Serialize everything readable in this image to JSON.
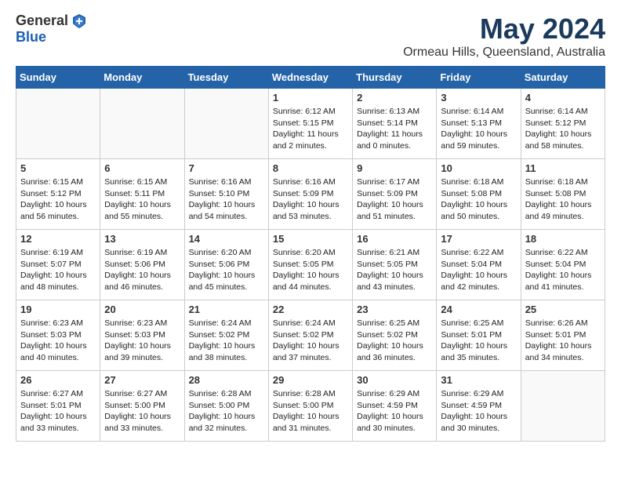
{
  "header": {
    "logo_line1": "General",
    "logo_line2": "Blue",
    "month_title": "May 2024",
    "location": "Ormeau Hills, Queensland, Australia"
  },
  "weekdays": [
    "Sunday",
    "Monday",
    "Tuesday",
    "Wednesday",
    "Thursday",
    "Friday",
    "Saturday"
  ],
  "weeks": [
    [
      {
        "day": "",
        "info": ""
      },
      {
        "day": "",
        "info": ""
      },
      {
        "day": "",
        "info": ""
      },
      {
        "day": "1",
        "info": "Sunrise: 6:12 AM\nSunset: 5:15 PM\nDaylight: 11 hours\nand 2 minutes."
      },
      {
        "day": "2",
        "info": "Sunrise: 6:13 AM\nSunset: 5:14 PM\nDaylight: 11 hours\nand 0 minutes."
      },
      {
        "day": "3",
        "info": "Sunrise: 6:14 AM\nSunset: 5:13 PM\nDaylight: 10 hours\nand 59 minutes."
      },
      {
        "day": "4",
        "info": "Sunrise: 6:14 AM\nSunset: 5:12 PM\nDaylight: 10 hours\nand 58 minutes."
      }
    ],
    [
      {
        "day": "5",
        "info": "Sunrise: 6:15 AM\nSunset: 5:12 PM\nDaylight: 10 hours\nand 56 minutes."
      },
      {
        "day": "6",
        "info": "Sunrise: 6:15 AM\nSunset: 5:11 PM\nDaylight: 10 hours\nand 55 minutes."
      },
      {
        "day": "7",
        "info": "Sunrise: 6:16 AM\nSunset: 5:10 PM\nDaylight: 10 hours\nand 54 minutes."
      },
      {
        "day": "8",
        "info": "Sunrise: 6:16 AM\nSunset: 5:09 PM\nDaylight: 10 hours\nand 53 minutes."
      },
      {
        "day": "9",
        "info": "Sunrise: 6:17 AM\nSunset: 5:09 PM\nDaylight: 10 hours\nand 51 minutes."
      },
      {
        "day": "10",
        "info": "Sunrise: 6:18 AM\nSunset: 5:08 PM\nDaylight: 10 hours\nand 50 minutes."
      },
      {
        "day": "11",
        "info": "Sunrise: 6:18 AM\nSunset: 5:08 PM\nDaylight: 10 hours\nand 49 minutes."
      }
    ],
    [
      {
        "day": "12",
        "info": "Sunrise: 6:19 AM\nSunset: 5:07 PM\nDaylight: 10 hours\nand 48 minutes."
      },
      {
        "day": "13",
        "info": "Sunrise: 6:19 AM\nSunset: 5:06 PM\nDaylight: 10 hours\nand 46 minutes."
      },
      {
        "day": "14",
        "info": "Sunrise: 6:20 AM\nSunset: 5:06 PM\nDaylight: 10 hours\nand 45 minutes."
      },
      {
        "day": "15",
        "info": "Sunrise: 6:20 AM\nSunset: 5:05 PM\nDaylight: 10 hours\nand 44 minutes."
      },
      {
        "day": "16",
        "info": "Sunrise: 6:21 AM\nSunset: 5:05 PM\nDaylight: 10 hours\nand 43 minutes."
      },
      {
        "day": "17",
        "info": "Sunrise: 6:22 AM\nSunset: 5:04 PM\nDaylight: 10 hours\nand 42 minutes."
      },
      {
        "day": "18",
        "info": "Sunrise: 6:22 AM\nSunset: 5:04 PM\nDaylight: 10 hours\nand 41 minutes."
      }
    ],
    [
      {
        "day": "19",
        "info": "Sunrise: 6:23 AM\nSunset: 5:03 PM\nDaylight: 10 hours\nand 40 minutes."
      },
      {
        "day": "20",
        "info": "Sunrise: 6:23 AM\nSunset: 5:03 PM\nDaylight: 10 hours\nand 39 minutes."
      },
      {
        "day": "21",
        "info": "Sunrise: 6:24 AM\nSunset: 5:02 PM\nDaylight: 10 hours\nand 38 minutes."
      },
      {
        "day": "22",
        "info": "Sunrise: 6:24 AM\nSunset: 5:02 PM\nDaylight: 10 hours\nand 37 minutes."
      },
      {
        "day": "23",
        "info": "Sunrise: 6:25 AM\nSunset: 5:02 PM\nDaylight: 10 hours\nand 36 minutes."
      },
      {
        "day": "24",
        "info": "Sunrise: 6:25 AM\nSunset: 5:01 PM\nDaylight: 10 hours\nand 35 minutes."
      },
      {
        "day": "25",
        "info": "Sunrise: 6:26 AM\nSunset: 5:01 PM\nDaylight: 10 hours\nand 34 minutes."
      }
    ],
    [
      {
        "day": "26",
        "info": "Sunrise: 6:27 AM\nSunset: 5:01 PM\nDaylight: 10 hours\nand 33 minutes."
      },
      {
        "day": "27",
        "info": "Sunrise: 6:27 AM\nSunset: 5:00 PM\nDaylight: 10 hours\nand 33 minutes."
      },
      {
        "day": "28",
        "info": "Sunrise: 6:28 AM\nSunset: 5:00 PM\nDaylight: 10 hours\nand 32 minutes."
      },
      {
        "day": "29",
        "info": "Sunrise: 6:28 AM\nSunset: 5:00 PM\nDaylight: 10 hours\nand 31 minutes."
      },
      {
        "day": "30",
        "info": "Sunrise: 6:29 AM\nSunset: 4:59 PM\nDaylight: 10 hours\nand 30 minutes."
      },
      {
        "day": "31",
        "info": "Sunrise: 6:29 AM\nSunset: 4:59 PM\nDaylight: 10 hours\nand 30 minutes."
      },
      {
        "day": "",
        "info": ""
      }
    ]
  ]
}
